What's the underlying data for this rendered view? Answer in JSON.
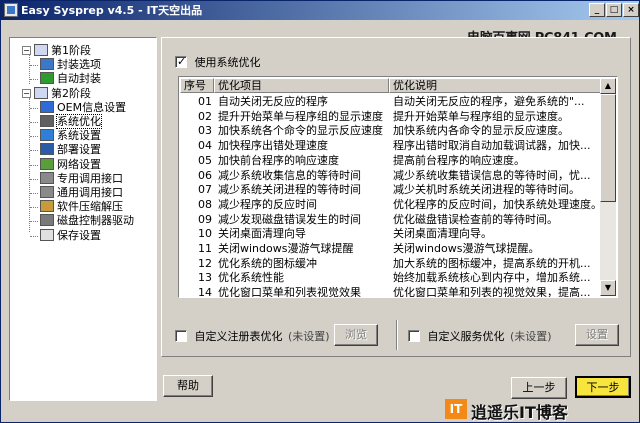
{
  "window": {
    "title": "Easy Sysprep v4.5 - IT天空出品",
    "minimize": "_",
    "restore": "□",
    "close": "×"
  },
  "tree": {
    "items": [
      {
        "label": "第1阶段",
        "level": 0,
        "expander": "−",
        "icon": "stage-icon"
      },
      {
        "label": "封装选项",
        "level": 1,
        "icon": "monitor-icon"
      },
      {
        "label": "自动封装",
        "level": 1,
        "icon": "arrow-right-icon"
      },
      {
        "label": "第2阶段",
        "level": 0,
        "expander": "−",
        "icon": "stage-icon"
      },
      {
        "label": "OEM信息设置",
        "level": 1,
        "icon": "info-icon"
      },
      {
        "label": "系统优化",
        "level": 1,
        "icon": "gear-icon"
      },
      {
        "label": "系统设置",
        "level": 1,
        "icon": "windows-icon"
      },
      {
        "label": "部署设置",
        "level": 1,
        "icon": "deploy-icon"
      },
      {
        "label": "网络设置",
        "level": 1,
        "icon": "network-icon"
      },
      {
        "label": "专用调用接口",
        "level": 1,
        "icon": "pen-icon"
      },
      {
        "label": "通用调用接口",
        "level": 1,
        "icon": "pen-icon"
      },
      {
        "label": "软件压缩解压",
        "level": 1,
        "icon": "box-icon"
      },
      {
        "label": "磁盘控制器驱动",
        "level": 1,
        "icon": "disk-icon"
      },
      {
        "label": "保存设置",
        "level": 1,
        "icon": "document-icon"
      }
    ]
  },
  "optimize": {
    "enable_label": "使用系统优化",
    "enabled": true,
    "columns": [
      "序号",
      "优化项目",
      "优化说明"
    ],
    "rows": [
      {
        "no": "01",
        "item": "自动关闭无反应的程序",
        "desc": "自动关闭无反应的程序，避免系统的\"...",
        "checked": true
      },
      {
        "no": "02",
        "item": "提升开始菜单与程序组的显示速度",
        "desc": "提升开始菜单与程序组的显示速度。",
        "checked": true
      },
      {
        "no": "03",
        "item": "加快系统各个命令的显示反应速度",
        "desc": "加快系统内各命令的显示反应速度。",
        "checked": true
      },
      {
        "no": "04",
        "item": "加快程序出错处理速度",
        "desc": "程序出错时取消自动加载调试器，加快...",
        "checked": true
      },
      {
        "no": "05",
        "item": "加快前台程序的响应速度",
        "desc": "提高前台程序的响应速度。",
        "checked": true
      },
      {
        "no": "06",
        "item": "减少系统收集信息的等待时间",
        "desc": "减少系统收集错误信息的等待时间，忧...",
        "checked": true
      },
      {
        "no": "07",
        "item": "减少系统关闭进程的等待时间",
        "desc": "减少关机时系统关闭进程的等待时间。",
        "checked": true
      },
      {
        "no": "08",
        "item": "减少程序的反应时间",
        "desc": "优化程序的反应时间，加快系统处理速度。",
        "checked": true
      },
      {
        "no": "09",
        "item": "减少发现磁盘错误发生的时间",
        "desc": "优化磁盘错误检查前的等待时间。",
        "checked": true
      },
      {
        "no": "10",
        "item": "关闭桌面清理向导",
        "desc": "关闭桌面清理向导。",
        "checked": true
      },
      {
        "no": "11",
        "item": "关闭windows漫游气球提醒",
        "desc": "关闭windows漫游气球提醒。",
        "checked": true
      },
      {
        "no": "12",
        "item": "优化系统的图标缓冲",
        "desc": "加大系统的图标缓冲，提高系统的开机...",
        "checked": true
      },
      {
        "no": "13",
        "item": "优化系统性能",
        "desc": "始终加载系统核心到内存中，增加系统...",
        "checked": true
      },
      {
        "no": "14",
        "item": "优化窗口菜单和列表视觉效果",
        "desc": "优化窗口菜单和列表的视觉效果，提高...",
        "checked": true
      }
    ],
    "scroll_up": "▲",
    "scroll_down": "▼"
  },
  "custom": {
    "registry_label": "自定义注册表优化",
    "registry_state": "(未设置)",
    "browse_label": "浏览",
    "service_label": "自定义服务优化",
    "service_state": "(未设置)",
    "settings_label": "设置"
  },
  "footer": {
    "help_label": "帮助",
    "prev_label": "上一步",
    "next_label": "下一步"
  },
  "watermarks": {
    "top": "电脑百事网 PC841.COM",
    "bottom_logo": "IT",
    "bottom": "逍遥乐IT博客"
  },
  "colors": {
    "title_start": "#0a246a",
    "title_end": "#a6caf0",
    "face": "#d4d0c8",
    "selection": "#0a246a"
  }
}
